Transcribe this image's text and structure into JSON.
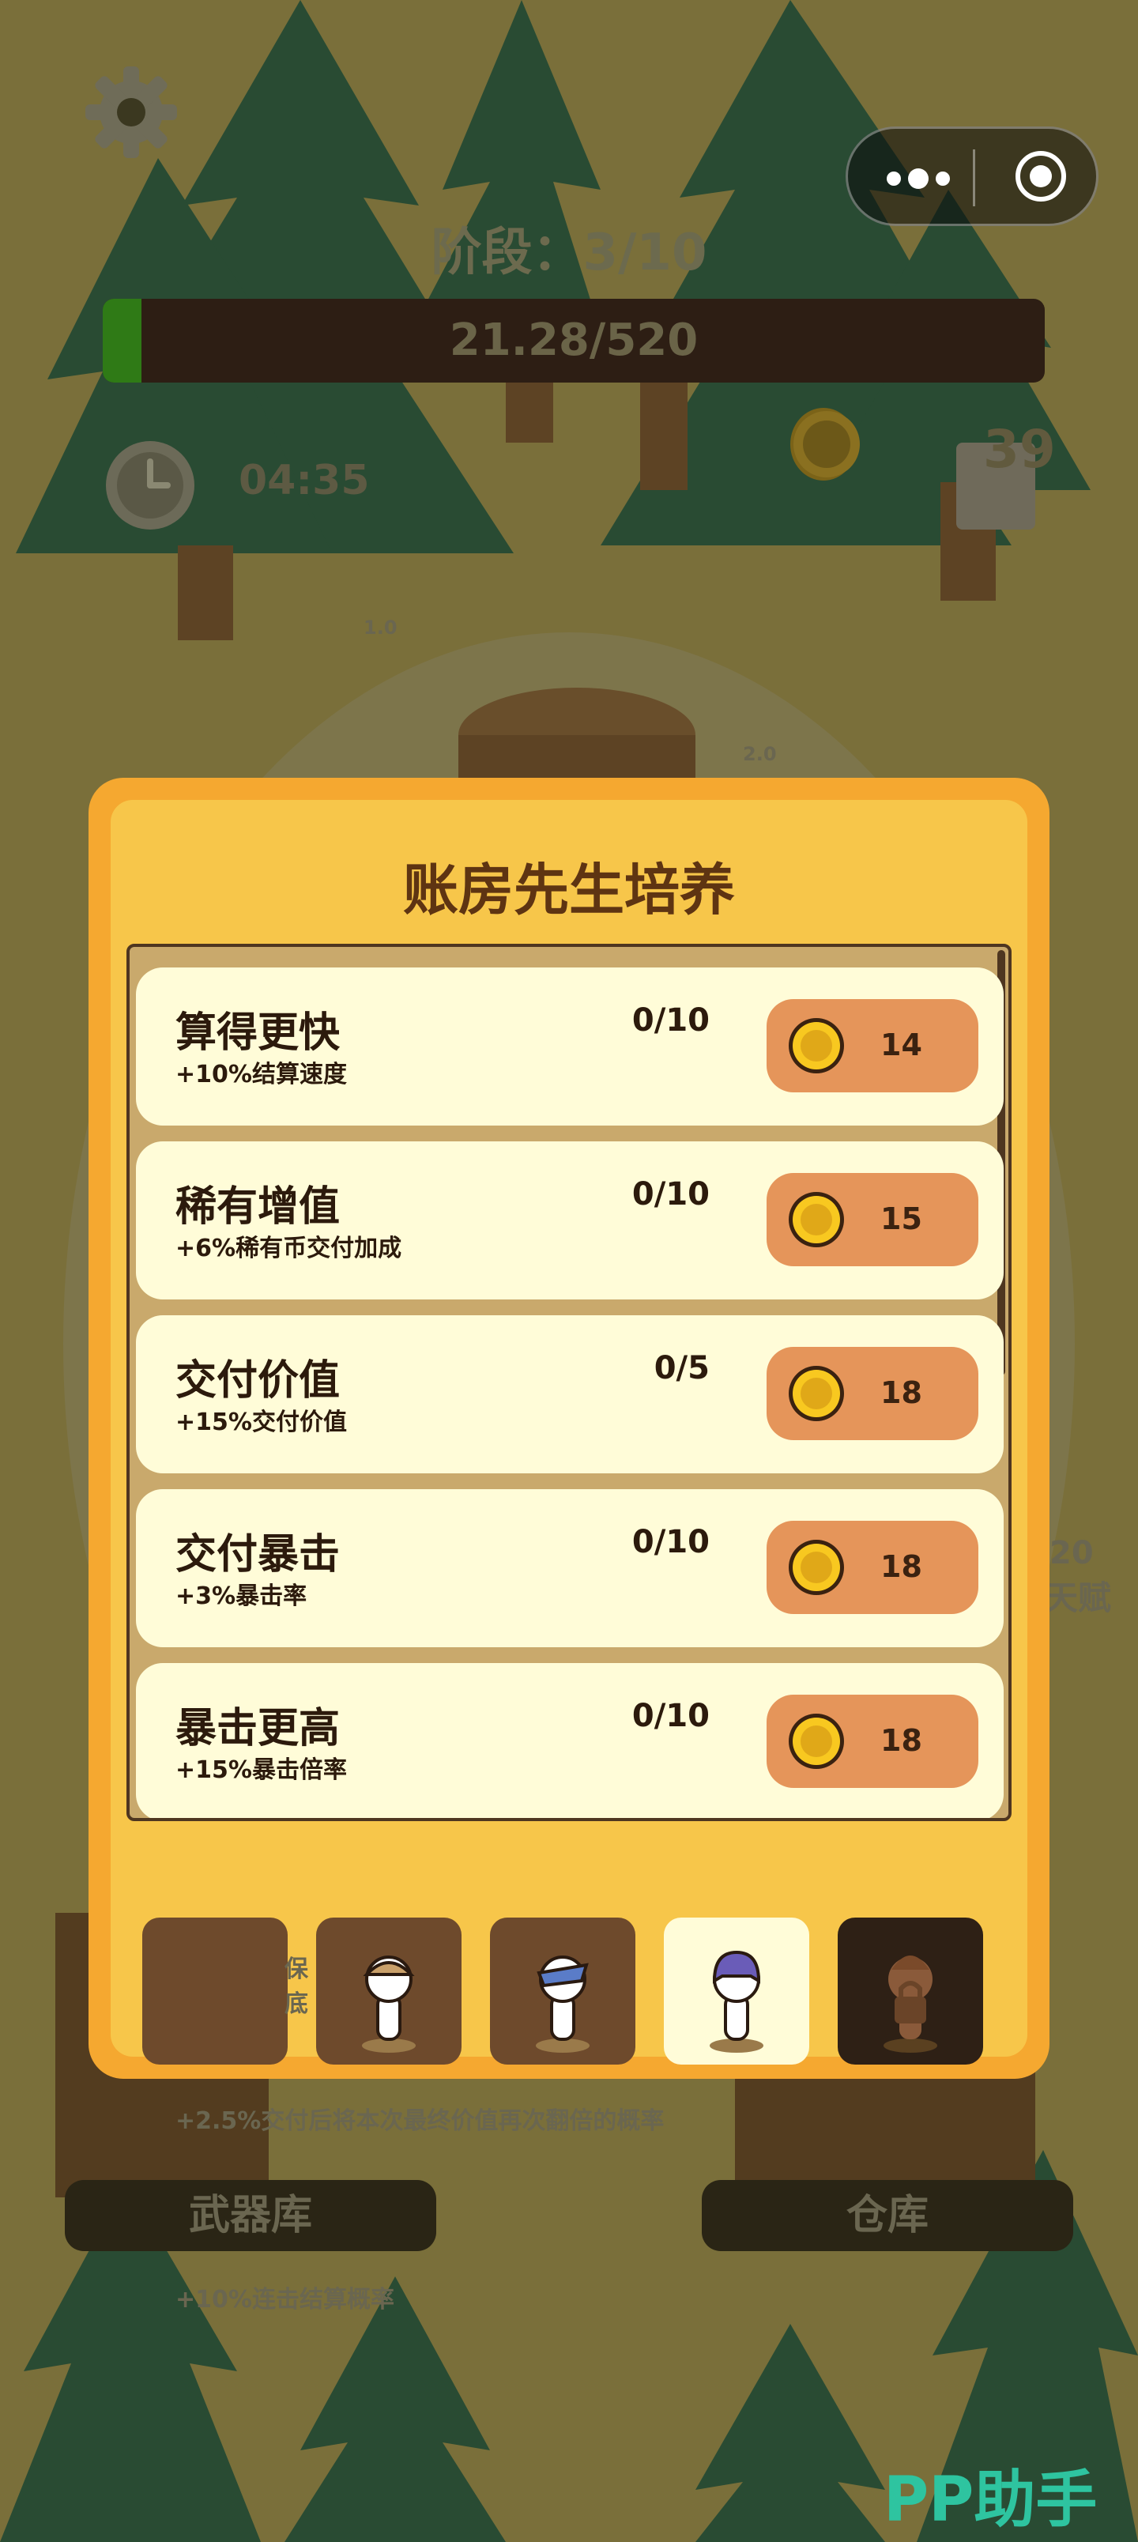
{
  "hud": {
    "stage_label": "阶段：3/10",
    "progress_text": "21.28/520",
    "progress_fraction": 0.041,
    "timer": "04:35",
    "coin_count": "39",
    "icons": [
      "gear-icon",
      "clock-icon",
      "coin-icon",
      "more-icon",
      "target-icon"
    ]
  },
  "background": {
    "float_1": "1.0",
    "float_2": "2.0",
    "side_counter": "20",
    "side_label": "天赋",
    "partial_text": "保底",
    "bonus_text_1": "+2.5%交付后将本次最终价值再次翻倍的概率",
    "bonus_text_2": "+10%连击结算概率",
    "armory_label": "武器库",
    "warehouse_label": "仓库"
  },
  "dialog": {
    "title": "账房先生培养",
    "upgrades": [
      {
        "name": "算得更快",
        "desc": "+10%结算速度",
        "level": "0/10",
        "cost": "14"
      },
      {
        "name": "稀有增值",
        "desc": "+6%稀有币交付加成",
        "level": "0/10",
        "cost": "15"
      },
      {
        "name": "交付价值",
        "desc": "+15%交付价值",
        "level": "0/5",
        "cost": "18"
      },
      {
        "name": "交付暴击",
        "desc": "+3%暴击率",
        "level": "0/10",
        "cost": "18"
      },
      {
        "name": "暴击更高",
        "desc": "+15%暴击倍率",
        "level": "0/10",
        "cost": "18"
      }
    ],
    "character_tabs": [
      {
        "state": "empty"
      },
      {
        "state": "unlocked",
        "hat": "#c9a06a"
      },
      {
        "state": "unlocked",
        "hat": "#5a7cc8"
      },
      {
        "state": "selected",
        "hat": "#6a5cb8"
      },
      {
        "state": "locked",
        "hat": "#8a5a3a"
      }
    ]
  },
  "watermark": "PP助手",
  "colors": {
    "dialog_outer": "#f5a830",
    "dialog_inner": "#f7c64a",
    "card": "#fffcd8",
    "buy_button": "#e5955a",
    "title": "#5e3412"
  }
}
